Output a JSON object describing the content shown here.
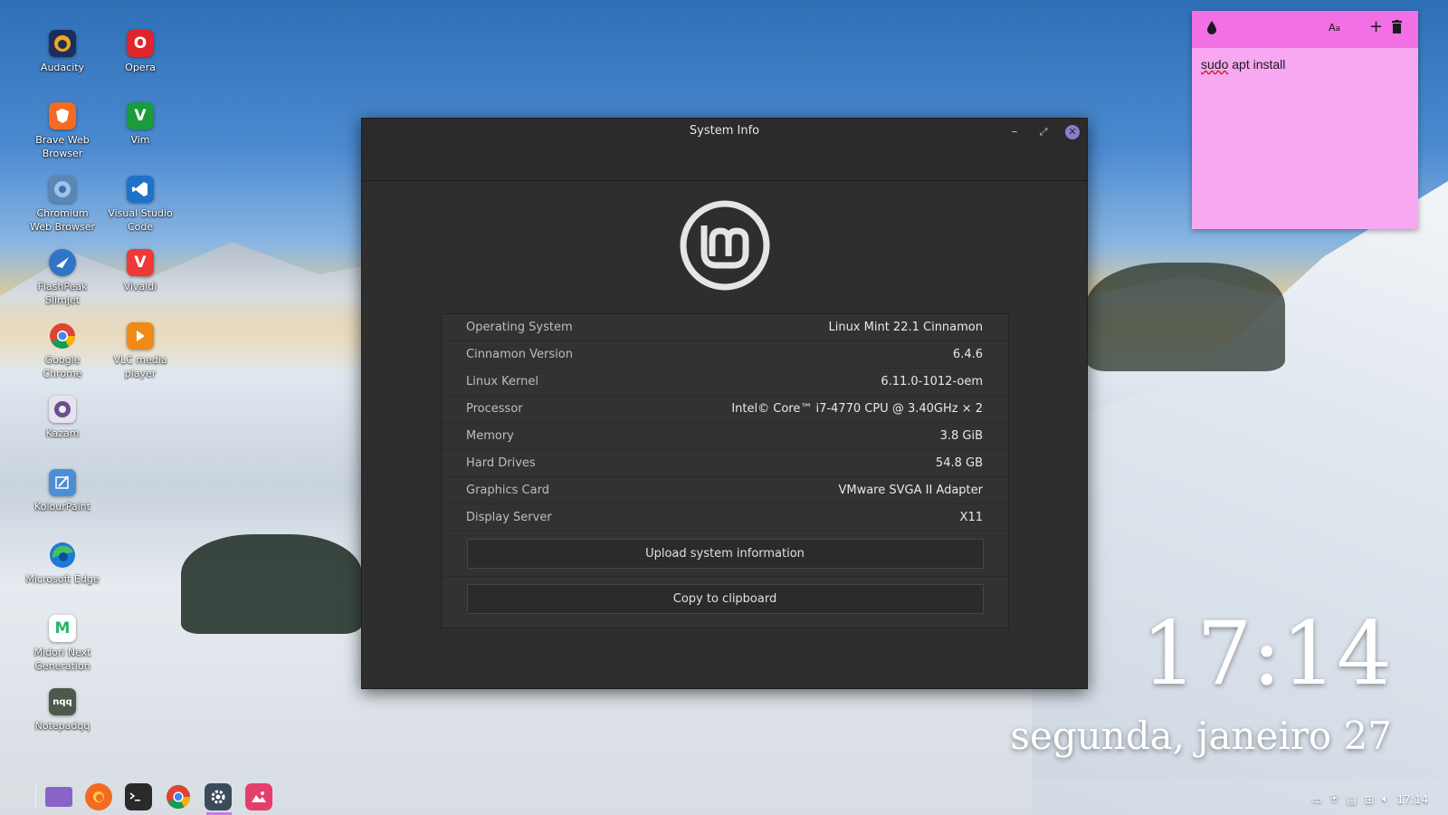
{
  "desktop": {
    "icons": [
      {
        "label": "Audacity",
        "icon": "audacity-icon"
      },
      {
        "label": "Opera",
        "icon": "opera-icon"
      },
      {
        "label": "Brave Web Browser",
        "icon": "brave-icon"
      },
      {
        "label": "Vim",
        "icon": "vim-icon"
      },
      {
        "label": "Chromium Web Browser",
        "icon": "chromium-icon"
      },
      {
        "label": "Visual Studio Code",
        "icon": "vscode-icon"
      },
      {
        "label": "FlashPeak Slimjet",
        "icon": "slimjet-icon"
      },
      {
        "label": "Vivaldi",
        "icon": "vivaldi-icon"
      },
      {
        "label": "Google Chrome",
        "icon": "chrome-icon"
      },
      {
        "label": "VLC media player",
        "icon": "vlc-icon"
      },
      {
        "label": "Kazam",
        "icon": "kazam-icon"
      },
      {
        "label": "KolourPaint",
        "icon": "kolourpaint-icon"
      },
      {
        "label": "Microsoft Edge",
        "icon": "edge-icon"
      },
      {
        "label": "Midori Next Generation",
        "icon": "midori-icon"
      },
      {
        "label": "Notepadqq",
        "icon": "notepadqq-icon"
      }
    ],
    "icon_glyphs": {
      "opera": "O",
      "vim": "V",
      "vivaldi": "V",
      "notepadqq": "nqq",
      "midori": "M"
    }
  },
  "window": {
    "title": "System Info",
    "minimize": "–",
    "maximize": "⤢",
    "close": "✕",
    "info": [
      {
        "key": "Operating System",
        "value": "Linux Mint 22.1 Cinnamon"
      },
      {
        "key": "Cinnamon Version",
        "value": "6.4.6"
      },
      {
        "key": "Linux Kernel",
        "value": "6.11.0-1012-oem"
      },
      {
        "key": "Processor",
        "value": "Intel© Core™ i7-4770 CPU @ 3.40GHz × 2"
      },
      {
        "key": "Memory",
        "value": "3.8 GiB"
      },
      {
        "key": "Hard Drives",
        "value": "54.8 GB"
      },
      {
        "key": "Graphics Card",
        "value": "VMware SVGA II Adapter"
      },
      {
        "key": "Display Server",
        "value": "X11"
      }
    ],
    "upload_label": "Upload system information",
    "copy_label": "Copy to clipboard"
  },
  "note": {
    "text_misspelled": "sudo",
    "text_rest": " apt install",
    "color": "#f7a8f0",
    "bar_color": "#f26fe6"
  },
  "clock": {
    "time": "17:14",
    "date": "segunda, janeiro 27"
  },
  "taskbar": {
    "tray_time": "17:14"
  }
}
